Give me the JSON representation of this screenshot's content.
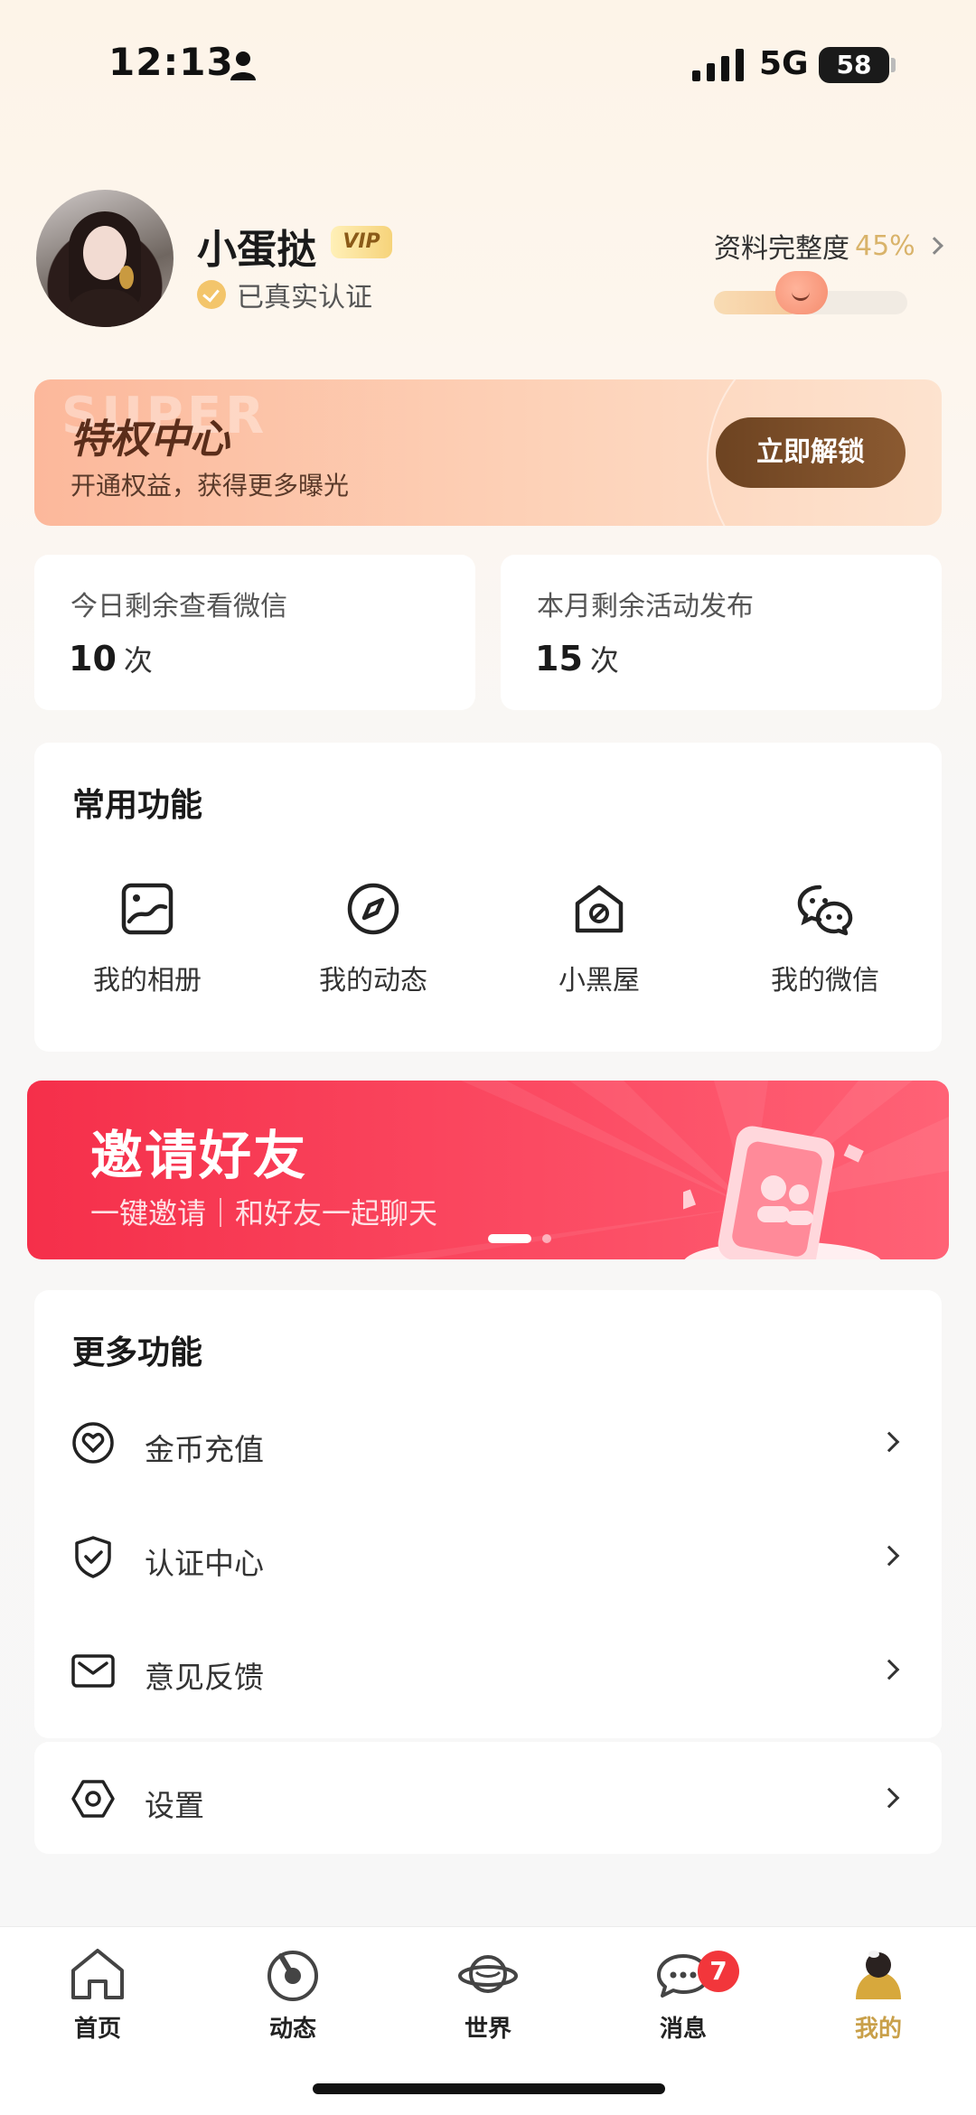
{
  "status_bar": {
    "time": "12:13",
    "network": "5G",
    "battery": "58"
  },
  "profile": {
    "name": "小蛋挞",
    "vip_badge": "VIP",
    "verified_text": "已真实认证",
    "completeness_label": "资料完整度",
    "completeness_value": "45%",
    "completeness_fraction": 0.45
  },
  "privilege": {
    "watermark": "SUPER",
    "title": "特权中心",
    "subtitle": "开通权益，获得更多曝光",
    "button": "立即解锁"
  },
  "quota": [
    {
      "label": "今日剩余查看微信",
      "value": "10",
      "unit": "次"
    },
    {
      "label": "本月剩余活动发布",
      "value": "15",
      "unit": "次"
    }
  ],
  "common_features": {
    "title": "常用功能",
    "items": [
      {
        "label": "我的相册",
        "icon": "photo-album-icon"
      },
      {
        "label": "我的动态",
        "icon": "compass-icon"
      },
      {
        "label": "小黑屋",
        "icon": "blocked-house-icon"
      },
      {
        "label": "我的微信",
        "icon": "wechat-icon"
      }
    ]
  },
  "invite_banner": {
    "title": "邀请好友",
    "subtitle": "一键邀请｜和好友一起聊天",
    "page_count": 2,
    "active_page": 1
  },
  "more_features": {
    "title": "更多功能",
    "items": [
      {
        "label": "金币充值",
        "icon": "heart-coin-icon"
      },
      {
        "label": "认证中心",
        "icon": "shield-check-icon"
      },
      {
        "label": "意见反馈",
        "icon": "mail-icon"
      },
      {
        "label": "设置",
        "icon": "hexagon-settings-icon"
      }
    ]
  },
  "tabbar": {
    "tabs": [
      {
        "label": "首页",
        "icon": "home-icon"
      },
      {
        "label": "动态",
        "icon": "moments-icon"
      },
      {
        "label": "世界",
        "icon": "planet-icon"
      },
      {
        "label": "消息",
        "icon": "chat-bubble-icon",
        "badge": "7"
      },
      {
        "label": "我的",
        "icon": "profile-icon",
        "active": true
      }
    ]
  },
  "colors": {
    "accent_gold": "#d9b36a",
    "privilege_button": "#6d4321",
    "invite_red": "#f52f4a",
    "badge_red": "#f2363b"
  }
}
